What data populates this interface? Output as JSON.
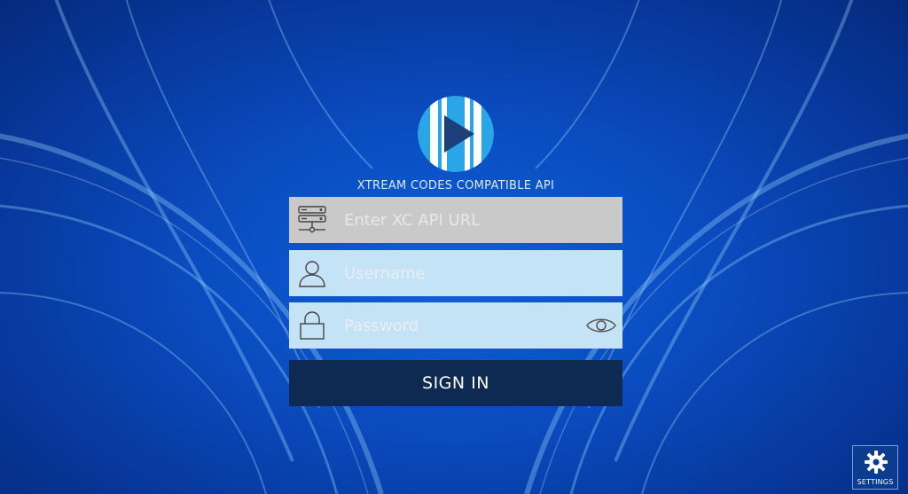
{
  "colors": {
    "background": "#0a4cc0",
    "logo_circle": "#2aa6e8",
    "url_field_bg": "#c9c9c9",
    "credential_field_bg": "#c5e3f6",
    "signin_bg": "#0e2a52"
  },
  "header": {
    "api_title": "XTREAM CODES COMPATIBLE API",
    "logo_icon": "play-logo-icon"
  },
  "form": {
    "url": {
      "placeholder": "Enter XC API URL",
      "icon": "server-icon"
    },
    "username": {
      "placeholder": "Username",
      "icon": "user-icon"
    },
    "password": {
      "placeholder": "Password",
      "icon": "lock-icon",
      "toggle_icon": "eye-icon"
    },
    "signin_label": "SIGN IN"
  },
  "settings": {
    "label": "SETTINGS",
    "icon": "gear-icon"
  }
}
